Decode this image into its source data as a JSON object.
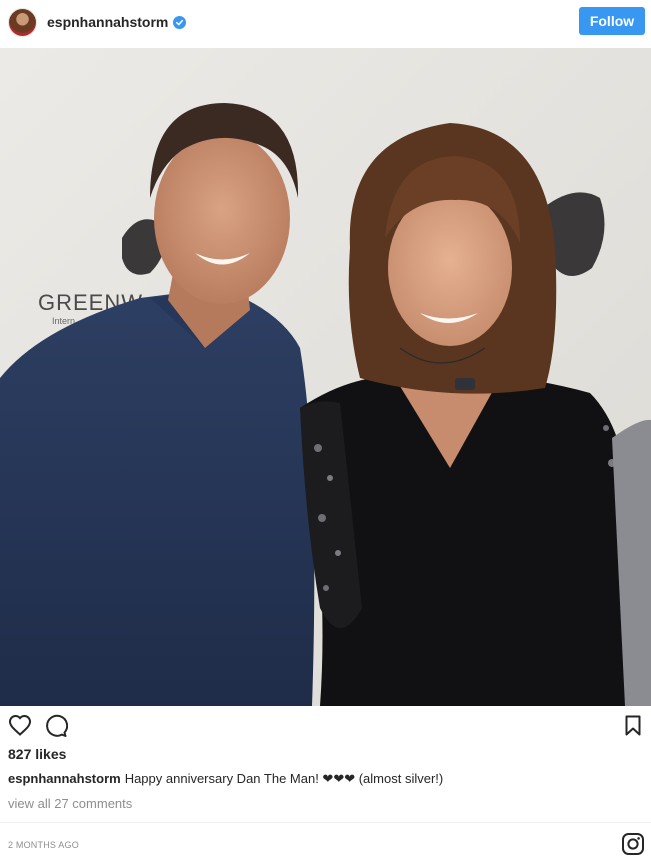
{
  "header": {
    "username": "espnhannahstorm",
    "follow_label": "Follow"
  },
  "photo": {
    "backdrop_text": "GREENW",
    "backdrop_subtext": "Intern"
  },
  "post": {
    "likes": "827 likes",
    "caption_user": "espnhannahstorm",
    "caption_text": "Happy anniversary Dan The Man! ❤❤❤ (almost silver!)",
    "view_comments": "view all 27 comments",
    "timestamp": "2 MONTHS AGO"
  },
  "icons": {
    "verified": "verified-badge-icon",
    "like": "heart-icon",
    "comment": "comment-icon",
    "save": "bookmark-icon",
    "brand": "instagram-icon"
  },
  "colors": {
    "accent": "#3897f0",
    "text": "#262626",
    "muted": "#8e8e8e"
  }
}
